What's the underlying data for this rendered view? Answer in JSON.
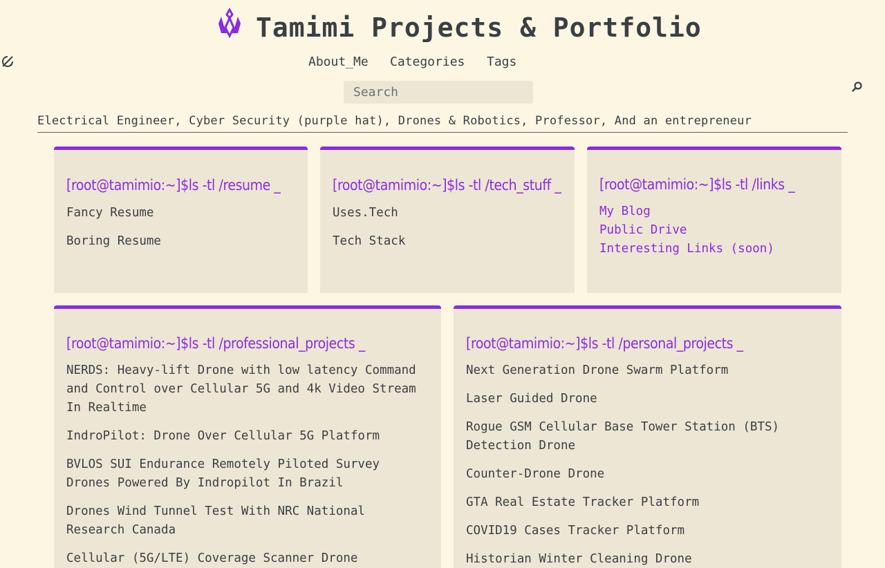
{
  "site": {
    "title": "Tamimi Projects & Portfolio",
    "tagline": "Electrical Engineer, Cyber Security (purple hat), Drones & Robotics, Professor, And an entrepreneur"
  },
  "nav": {
    "items": [
      {
        "label": "About_Me"
      },
      {
        "label": "Categories"
      },
      {
        "label": "Tags"
      }
    ],
    "theme_toggle_icon": "theme-toggle-icon"
  },
  "search": {
    "placeholder": "Search",
    "icon": "search-icon"
  },
  "colors": {
    "background": "#fdf6e3",
    "card_background": "#ede6d4",
    "accent": "#8a2be2",
    "text": "#3a3f44"
  },
  "cards": {
    "resume": {
      "heading": "[root@tamimio:~]$ls -tl /resume _",
      "items": [
        "Fancy Resume",
        "Boring Resume"
      ]
    },
    "tech": {
      "heading": "[root@tamimio:~]$ls -tl /tech_stuff _",
      "items": [
        "Uses.Tech",
        "Tech Stack"
      ]
    },
    "links": {
      "heading": "[root@tamimio:~]$ls -tl /links _",
      "items": [
        "My Blog",
        "Public Drive",
        "Interesting Links (soon)"
      ]
    },
    "professional": {
      "heading": "[root@tamimio:~]$ls -tl /professional_projects _",
      "items": [
        "NERDS: Heavy-lift Drone with low latency Command and Control over Cellular 5G and 4k Video Stream In Realtime",
        "IndroPilot: Drone Over Cellular 5G Platform",
        "BVLOS SUI Endurance Remotely Piloted Survey Drones Powered By Indropilot In Brazil",
        "Drones Wind Tunnel Test With NRC National Research Canada",
        "Cellular (5G/LTE) Coverage Scanner Drone"
      ]
    },
    "personal": {
      "heading": "[root@tamimio:~]$ls -tl /personal_projects _",
      "items": [
        "Next Generation Drone Swarm Platform",
        "Laser Guided Drone",
        "Rogue GSM Cellular Base Tower Station (BTS) Detection Drone",
        "Counter-Drone Drone",
        "GTA Real Estate Tracker Platform",
        "COVID19 Cases Tracker Platform",
        "Historian Winter Cleaning Drone"
      ]
    }
  }
}
